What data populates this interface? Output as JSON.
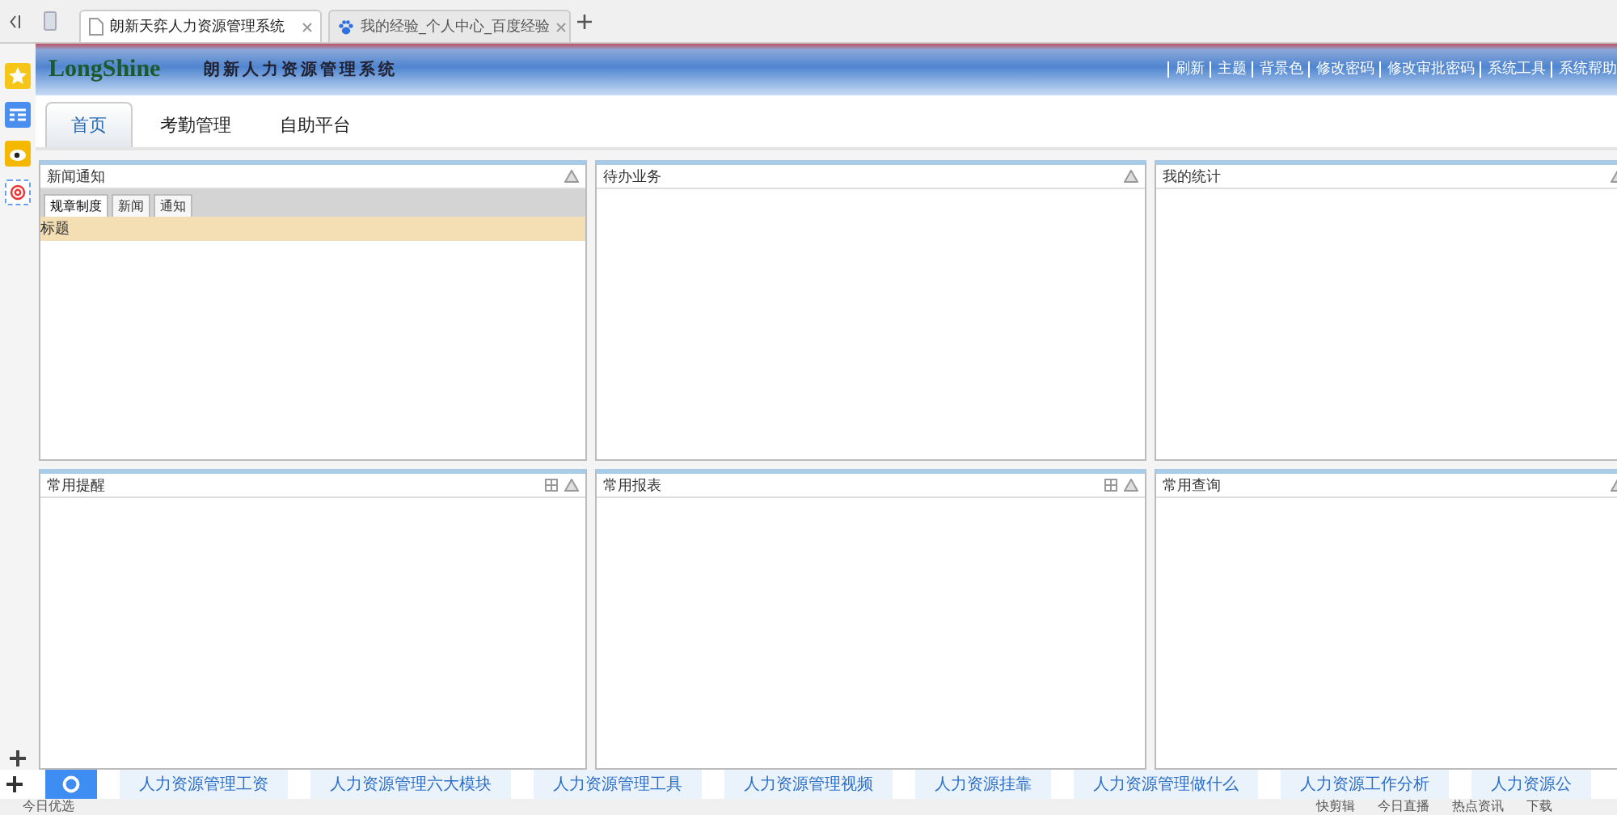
{
  "browser_tabs": [
    {
      "title": "朗新天弈人力资源管理系统",
      "selected": true
    },
    {
      "title": "我的经验_个人中心_百度经验",
      "selected": false
    }
  ],
  "header": {
    "logo": "LongShine",
    "title": "朗新人力资源管理系统",
    "links": [
      "刷新",
      "主题",
      "背景色",
      "修改密码",
      "修改审批密码",
      "系统工具",
      "系统帮助"
    ]
  },
  "nav_tabs": [
    {
      "label": "首页",
      "selected": true
    },
    {
      "label": "考勤管理",
      "selected": false
    },
    {
      "label": "自助平台",
      "selected": false
    }
  ],
  "panels": [
    {
      "title": "新闻通知",
      "grid_button": false,
      "subtabs": [
        {
          "label": "规章制度",
          "selected": true
        },
        {
          "label": "新闻",
          "selected": false
        },
        {
          "label": "通知",
          "selected": false
        }
      ],
      "column_header": "标题"
    },
    {
      "title": "待办业务",
      "grid_button": false
    },
    {
      "title": "我的统计",
      "grid_button": false
    },
    {
      "title": "常用提醒",
      "grid_button": true
    },
    {
      "title": "常用报表",
      "grid_button": true
    },
    {
      "title": "常用查询",
      "grid_button": false
    }
  ],
  "search_links": [
    "人力资源管理工资",
    "人力资源管理六大模块",
    "人力资源管理工具",
    "人力资源管理视频",
    "人力资源挂靠",
    "人力资源管理做什么",
    "人力资源工作分析",
    "人力资源公"
  ],
  "status_bar": {
    "left": "今日优选",
    "items": [
      "快剪辑",
      "今日直播",
      "热点资讯",
      "下载"
    ]
  }
}
